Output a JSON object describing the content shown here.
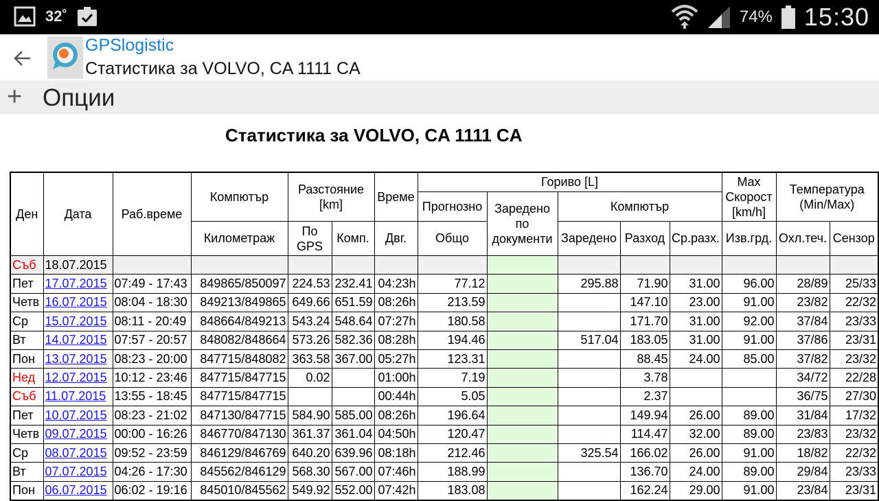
{
  "status_bar": {
    "temperature": "32˚",
    "battery": "74%",
    "time": "15:30"
  },
  "app": {
    "name": "GPSlogistic",
    "subtitle": "Статистика за VOLVO, CA 1111 CA"
  },
  "options": {
    "label": "Опции"
  },
  "page_title": "Статистика за VOLVO, CA 1111 CA",
  "table": {
    "headers": {
      "day": "Ден",
      "date": "Дата",
      "work_time": "Раб.време",
      "computer": "Компютър",
      "distance": "Разстояние [km]",
      "time": "Време",
      "fuel": "Гориво [L]",
      "max_speed": "Max Скорост [km/h]",
      "temperature": "Температура (Min/Max)",
      "forecast": "Прогнозно",
      "refueled_docs": "Заредено по документи",
      "fuel_computer": "Компютър",
      "mileage": "Километраж",
      "gps": "По GPS",
      "comp": "Комп.",
      "movement": "Двг.",
      "total": "Общо",
      "refueled": "Заредено",
      "consumption": "Разход",
      "avg_consumption": "Ср.разх.",
      "calc": "Изв.грд.",
      "coolant": "Охл.теч.",
      "sensor": "Сензор"
    },
    "rows": [
      {
        "day": "Съб",
        "weekend": true,
        "date": "18.07.2015",
        "link": false,
        "work": "",
        "km": "",
        "gps": "",
        "comp": "",
        "mov": "",
        "total": "",
        "docs": "",
        "refuel": "",
        "cons": "",
        "avg": "",
        "speed": "",
        "cool": "",
        "sensor": ""
      },
      {
        "day": "Пет",
        "weekend": false,
        "date": "17.07.2015",
        "link": true,
        "work": "07:49 - 17:43",
        "km": "849865/850097",
        "gps": "224.53",
        "comp": "232.41",
        "mov": "04:23h",
        "total": "77.12",
        "docs": "",
        "refuel": "295.88",
        "cons": "71.90",
        "avg": "31.00",
        "speed": "96.00",
        "cool": "28/89",
        "sensor": "25/33"
      },
      {
        "day": "Четв",
        "weekend": false,
        "date": "16.07.2015",
        "link": true,
        "work": "08:04 - 18:30",
        "km": "849213/849865",
        "gps": "649.66",
        "comp": "651.59",
        "mov": "08:26h",
        "total": "213.59",
        "docs": "",
        "refuel": "",
        "cons": "147.10",
        "avg": "23.00",
        "speed": "91.00",
        "cool": "23/82",
        "sensor": "22/32"
      },
      {
        "day": "Ср",
        "weekend": false,
        "date": "15.07.2015",
        "link": true,
        "work": "08:11 - 20:49",
        "km": "848664/849213",
        "gps": "543.24",
        "comp": "548.64",
        "mov": "07:27h",
        "total": "180.58",
        "docs": "",
        "refuel": "",
        "cons": "171.70",
        "avg": "31.00",
        "speed": "92.00",
        "cool": "37/84",
        "sensor": "23/33"
      },
      {
        "day": "Вт",
        "weekend": false,
        "date": "14.07.2015",
        "link": true,
        "work": "07:57 - 20:57",
        "km": "848082/848664",
        "gps": "573.26",
        "comp": "582.36",
        "mov": "08:28h",
        "total": "194.46",
        "docs": "",
        "refuel": "517.04",
        "cons": "183.05",
        "avg": "31.00",
        "speed": "91.00",
        "cool": "37/86",
        "sensor": "23/31"
      },
      {
        "day": "Пон",
        "weekend": false,
        "date": "13.07.2015",
        "link": true,
        "work": "08:23 - 20:00",
        "km": "847715/848082",
        "gps": "363.58",
        "comp": "367.00",
        "mov": "05:27h",
        "total": "123.31",
        "docs": "",
        "refuel": "",
        "cons": "88.45",
        "avg": "24.00",
        "speed": "85.00",
        "cool": "37/82",
        "sensor": "23/32"
      },
      {
        "day": "Нед",
        "weekend": true,
        "date": "12.07.2015",
        "link": true,
        "work": "10:12 - 23:46",
        "km": "847715/847715",
        "gps": "0.02",
        "comp": "",
        "mov": "01:00h",
        "total": "7.19",
        "docs": "",
        "refuel": "",
        "cons": "3.78",
        "avg": "",
        "speed": "",
        "cool": "34/72",
        "sensor": "22/28"
      },
      {
        "day": "Съб",
        "weekend": true,
        "date": "11.07.2015",
        "link": true,
        "work": "13:55 - 18:45",
        "km": "847715/847715",
        "gps": "",
        "comp": "",
        "mov": "00:44h",
        "total": "5.05",
        "docs": "",
        "refuel": "",
        "cons": "2.37",
        "avg": "",
        "speed": "",
        "cool": "36/75",
        "sensor": "27/30"
      },
      {
        "day": "Пет",
        "weekend": false,
        "date": "10.07.2015",
        "link": true,
        "work": "08:23 - 21:02",
        "km": "847130/847715",
        "gps": "584.90",
        "comp": "585.00",
        "mov": "08:26h",
        "total": "196.64",
        "docs": "",
        "refuel": "",
        "cons": "149.94",
        "avg": "26.00",
        "speed": "89.00",
        "cool": "31/84",
        "sensor": "17/32"
      },
      {
        "day": "Четв",
        "weekend": false,
        "date": "09.07.2015",
        "link": true,
        "work": "00:00 - 16:26",
        "km": "846770/847130",
        "gps": "361.37",
        "comp": "361.04",
        "mov": "04:50h",
        "total": "120.47",
        "docs": "",
        "refuel": "",
        "cons": "114.47",
        "avg": "32.00",
        "speed": "89.00",
        "cool": "23/83",
        "sensor": "23/32"
      },
      {
        "day": "Ср",
        "weekend": false,
        "date": "08.07.2015",
        "link": true,
        "work": "09:52 - 23:59",
        "km": "846129/846769",
        "gps": "640.20",
        "comp": "639.96",
        "mov": "08:18h",
        "total": "212.46",
        "docs": "",
        "refuel": "325.54",
        "cons": "166.02",
        "avg": "26.00",
        "speed": "91.00",
        "cool": "18/82",
        "sensor": "22/32"
      },
      {
        "day": "Вт",
        "weekend": false,
        "date": "07.07.2015",
        "link": true,
        "work": "04:26 - 17:30",
        "km": "845562/846129",
        "gps": "568.30",
        "comp": "567.00",
        "mov": "07:46h",
        "total": "188.99",
        "docs": "",
        "refuel": "",
        "cons": "136.70",
        "avg": "24.00",
        "speed": "89.00",
        "cool": "29/84",
        "sensor": "23/33"
      },
      {
        "day": "Пон",
        "weekend": false,
        "date": "06.07.2015",
        "link": true,
        "work": "06:02 - 19:16",
        "km": "845010/845562",
        "gps": "549.92",
        "comp": "552.00",
        "mov": "07:42h",
        "total": "183.08",
        "docs": "",
        "refuel": "",
        "cons": "162.24",
        "avg": "29.00",
        "speed": "91.00",
        "cool": "23/84",
        "sensor": "23/31"
      }
    ]
  }
}
